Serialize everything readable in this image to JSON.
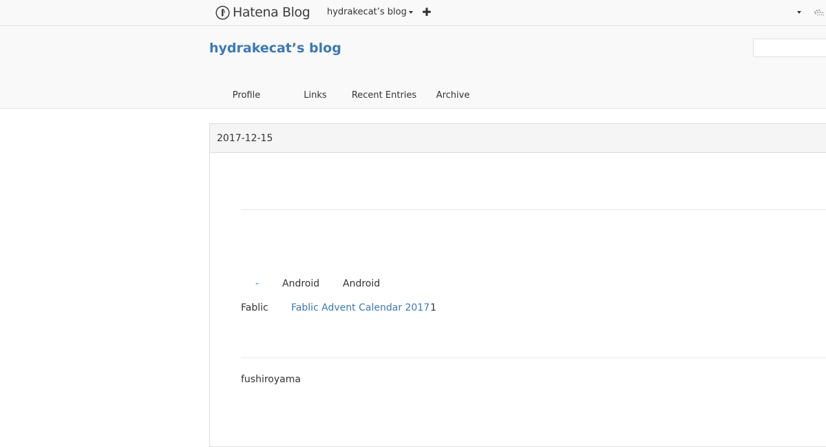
{
  "global_header": {
    "logo_text": "Hatena Blog",
    "blog_switcher_label": "hydrakecat’s blog",
    "add_button_glyph": "✚"
  },
  "blog": {
    "title": "hydrakecat’s blog",
    "search_placeholder": "",
    "nav": [
      "Profile",
      "Links",
      "Recent Entries",
      "Archive"
    ]
  },
  "entry": {
    "date": "2017-12-15",
    "tag_dash": "-",
    "tag_android_1": "Android",
    "tag_android_2": "Android",
    "fablic_label": "Fablic",
    "advent_link": "Fablic Advent Calendar 2017",
    "advent_suffix": "1",
    "author": "fushiroyama"
  },
  "colors": {
    "link": "#3b78b5",
    "header_bg": "#f9f9f9",
    "date_bar_bg": "#f5f5f5"
  },
  "icons": {
    "logo": "hatena-logo-icon",
    "add": "plus-icon",
    "user": "avatar-icon"
  }
}
